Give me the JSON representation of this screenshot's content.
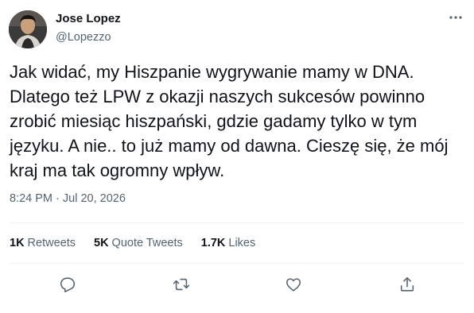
{
  "author": {
    "name": "Jose Lopez",
    "handle": "@Lopezzo",
    "avatar_icon": "profile-photo"
  },
  "tweet": {
    "text": "Jak widać, my Hiszpanie wygrywanie mamy w DNA.\nDlatego też LPW z okazji naszych sukcesów powinno\nzrobić miesiąc hiszpański, gdzie gadamy tylko w tym\njęzyku. A nie.. to już mamy od dawna. Cieszę się, że mój\nkraj ma tak ogromny wpływ.",
    "timestamp": "8:24 PM · Jul 20, 2026"
  },
  "stats": {
    "retweets_count": "1K",
    "retweets_label": "Retweets",
    "quotes_count": "5K",
    "quotes_label": "Quote Tweets",
    "likes_count": "1.7K",
    "likes_label": "Likes"
  },
  "icons": {
    "more": "more-horizontal-icon",
    "reply": "reply-icon",
    "retweet": "retweet-icon",
    "like": "like-icon",
    "share": "share-icon"
  },
  "colors": {
    "text": "#0f1419",
    "secondary": "#536471",
    "divider": "#eff3f4"
  }
}
